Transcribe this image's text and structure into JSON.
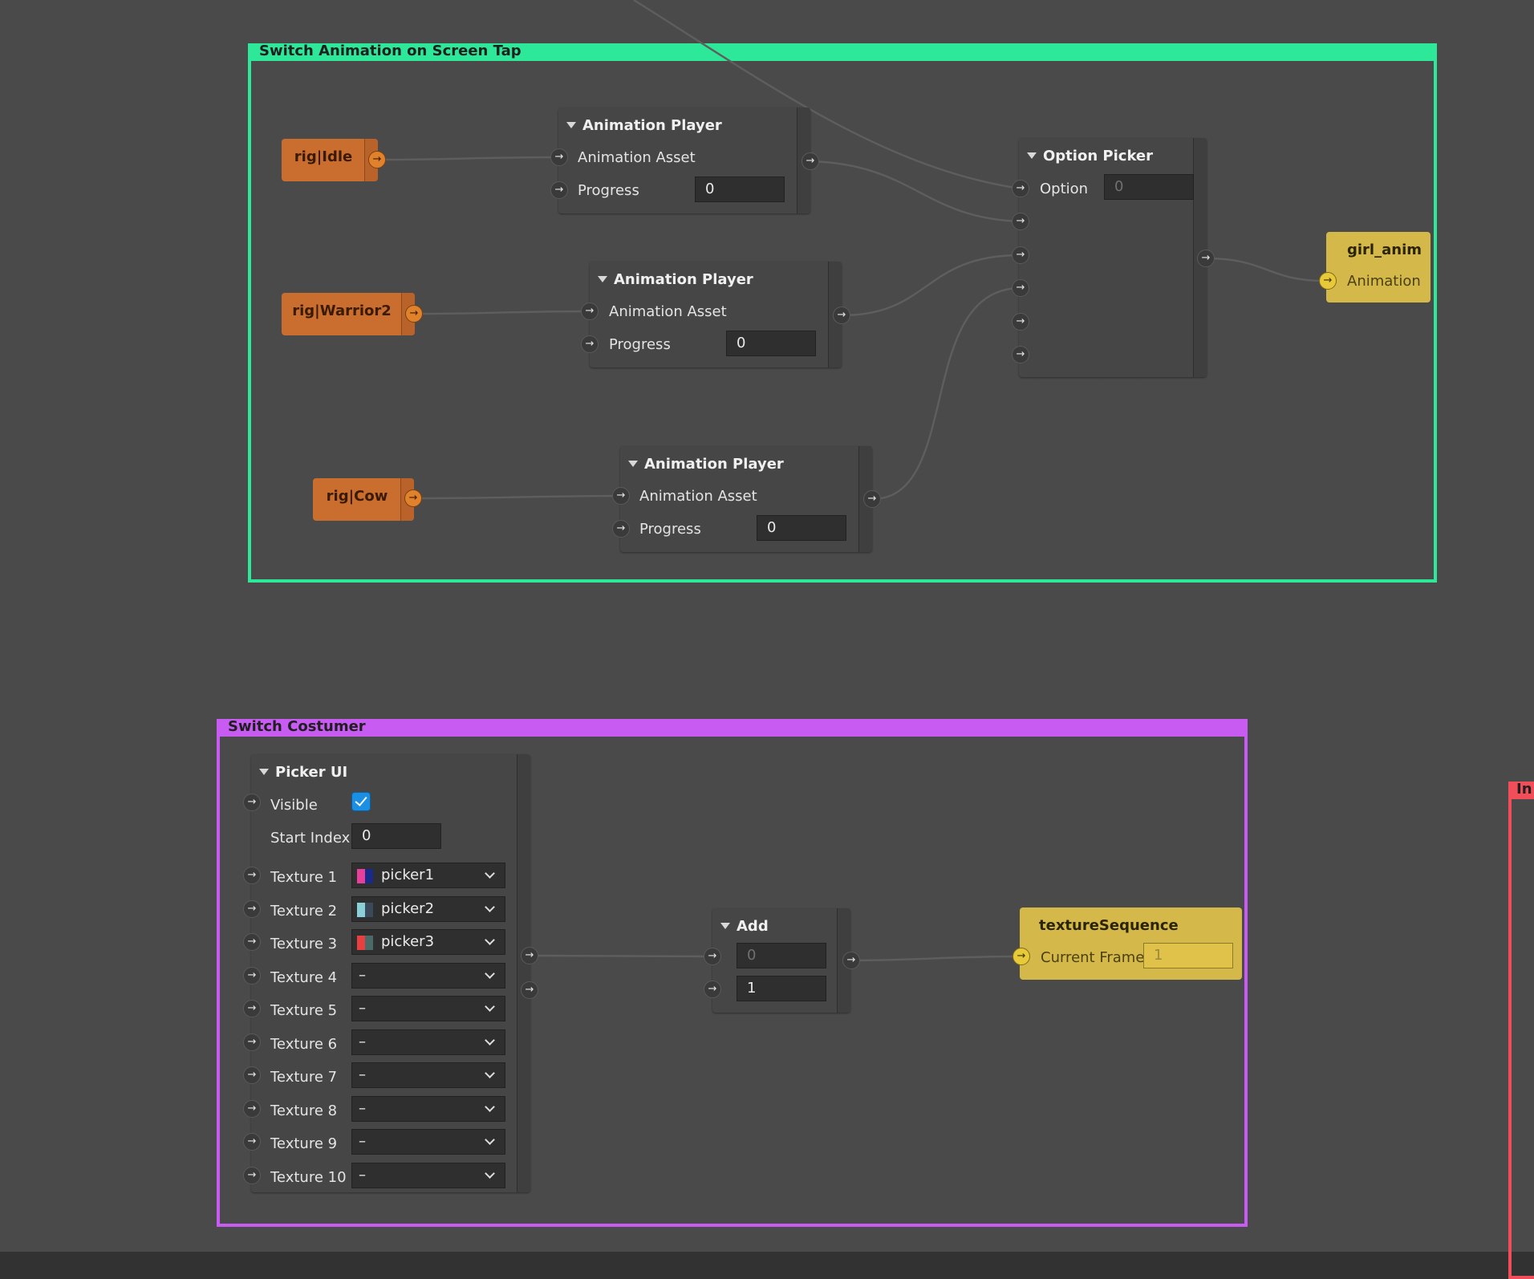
{
  "colors": {
    "canvas_bg": "#323232",
    "group_green": "#2ee89a",
    "group_purple": "#c85cf2",
    "group_red": "#f24e5a",
    "patch_orange": "#c96e2e",
    "patch_yellow": "#d4b94a",
    "checkbox_blue": "#1a8fe3"
  },
  "groups": {
    "animation": {
      "title": "Switch Animation on Screen Tap"
    },
    "costume": {
      "title": "Switch Costumer"
    },
    "right": {
      "title": "In"
    }
  },
  "anim_assets": [
    {
      "label": "rig|Idle"
    },
    {
      "label": "rig|Warrior2"
    },
    {
      "label": "rig|Cow"
    }
  ],
  "animation_players": [
    {
      "title": "Animation Player",
      "asset_label": "Animation Asset",
      "progress_label": "Progress",
      "progress_value": "0"
    },
    {
      "title": "Animation Player",
      "asset_label": "Animation Asset",
      "progress_label": "Progress",
      "progress_value": "0"
    },
    {
      "title": "Animation Player",
      "asset_label": "Animation Asset",
      "progress_label": "Progress",
      "progress_value": "0"
    }
  ],
  "option_picker": {
    "title": "Option Picker",
    "option_label": "Option",
    "option_value": "0"
  },
  "girl_anim": {
    "title": "girl_anim",
    "input_label": "Animation"
  },
  "picker_ui": {
    "title": "Picker UI",
    "visible_label": "Visible",
    "visible_checked": true,
    "start_index_label": "Start Index",
    "start_index_value": "0",
    "textures": [
      {
        "label": "Texture 1",
        "value": "picker1",
        "swatch": [
          "#e8409a",
          "#1a2a8a"
        ]
      },
      {
        "label": "Texture 2",
        "value": "picker2",
        "swatch": [
          "#8ad0d8",
          "#3a4a5a"
        ]
      },
      {
        "label": "Texture 3",
        "value": "picker3",
        "swatch": [
          "#e84040",
          "#4a6a6a"
        ]
      },
      {
        "label": "Texture 4",
        "value": "–"
      },
      {
        "label": "Texture 5",
        "value": "–"
      },
      {
        "label": "Texture 6",
        "value": "–"
      },
      {
        "label": "Texture 7",
        "value": "–"
      },
      {
        "label": "Texture 8",
        "value": "–"
      },
      {
        "label": "Texture 9",
        "value": "–"
      },
      {
        "label": "Texture 10",
        "value": "–"
      }
    ]
  },
  "add_node": {
    "title": "Add",
    "input1": "0",
    "input2": "1"
  },
  "texture_sequence": {
    "title": "textureSequence",
    "frame_label": "Current Frame",
    "frame_value": "1"
  },
  "icons": {
    "port": "arrow-right",
    "collapse": "triangle-down",
    "dropdown": "chevron-down"
  }
}
